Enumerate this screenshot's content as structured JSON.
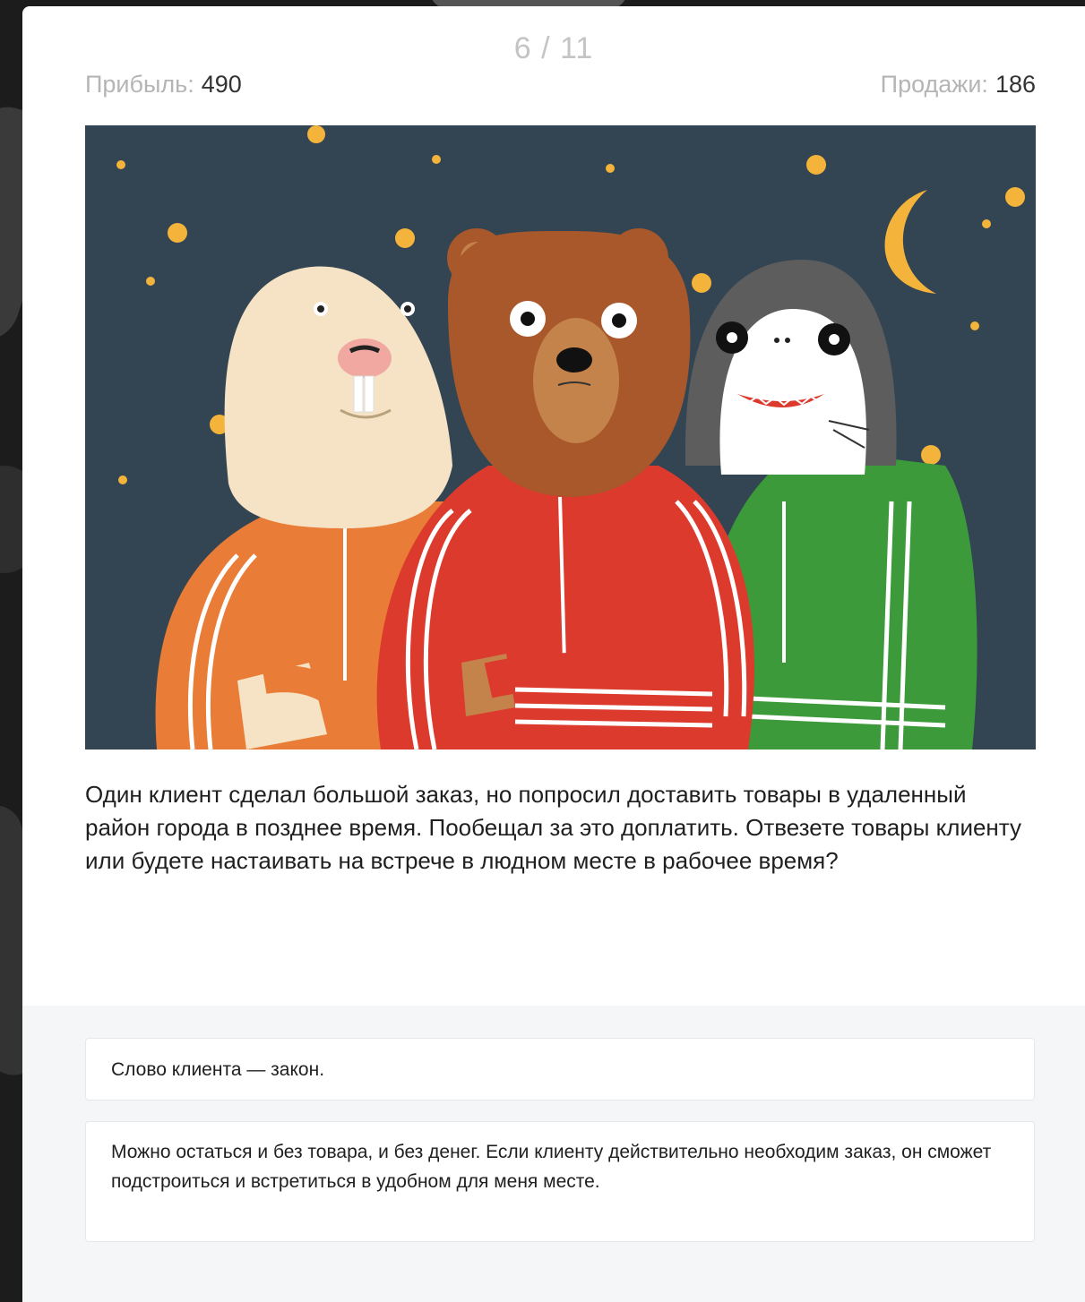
{
  "progress": {
    "current": 6,
    "total": 11,
    "label": "6 / 11"
  },
  "stats": {
    "profit_label": "Прибыль:",
    "profit_value": "490",
    "sales_label": "Продажи:",
    "sales_value": "186"
  },
  "illustration": {
    "description_icon": "three-animals-in-tracksuits-illustration",
    "colors": {
      "sky": "#334553",
      "stars": "#f4b33a",
      "bear": "#a8582a",
      "bear_muzzle": "#c4834a",
      "walrus": "#f6e3c5",
      "shark": "#5d5d5d",
      "orange_jacket": "#e97c36",
      "red_jacket": "#dd3a2e",
      "green_jacket": "#3c9a3a"
    }
  },
  "question": {
    "text": "Один клиент сделал большой заказ, но попросил доставить товары в удаленный район города в позднее время. Пообещал за это доплатить. Отвезете товары клиенту или будете настаивать на встрече в людном месте в рабочее время?"
  },
  "answers": [
    {
      "text": "Слово клиента — закон."
    },
    {
      "text": "Можно остаться и без товара, и без денег. Если клиенту действительно необходим заказ, он сможет подстроиться и встретиться в удобном для меня месте."
    }
  ]
}
